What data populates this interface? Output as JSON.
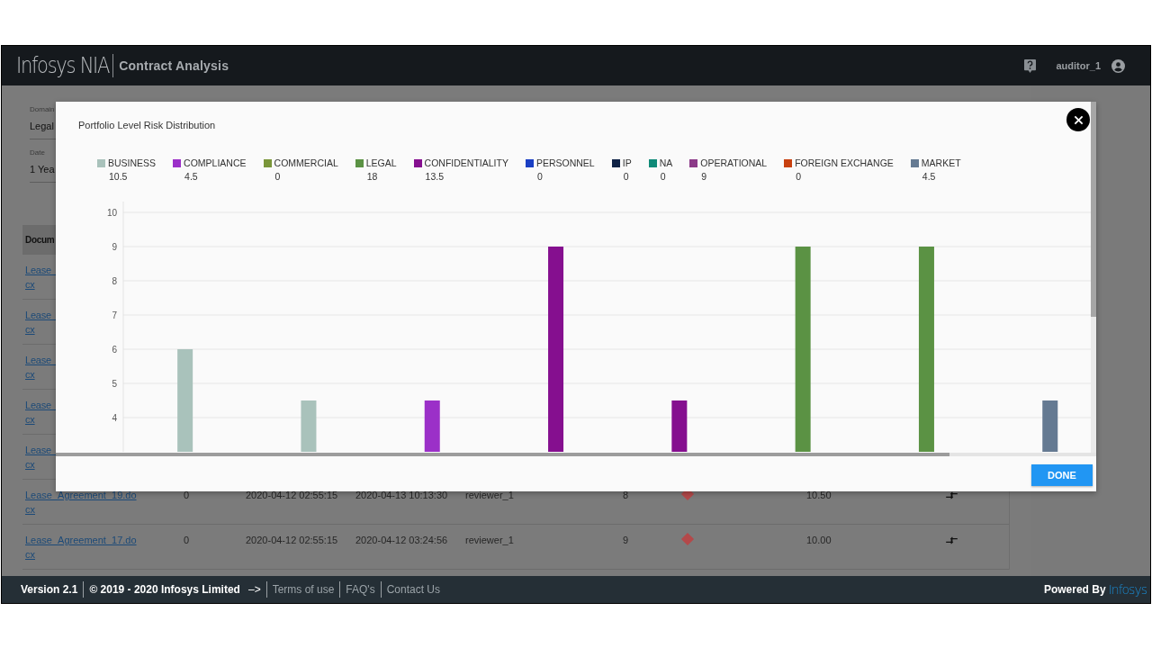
{
  "header": {
    "logo": "Infosys NIA",
    "title": "Contract Analysis",
    "user": "auditor_1"
  },
  "filters": [
    {
      "label": "Domain",
      "value": "Legal"
    },
    {
      "label": "Date",
      "value": "1 Yea"
    }
  ],
  "table": {
    "column_1": "Docum",
    "rows": [
      {
        "document": [
          "Lease_",
          "cx"
        ]
      },
      {
        "document": [
          "Lease_",
          "cx"
        ]
      },
      {
        "document": [
          "Lease_",
          "cx"
        ]
      },
      {
        "document": [
          "Lease_",
          "cx"
        ]
      },
      {
        "document": [
          "Lease_",
          "cx"
        ]
      },
      {
        "document": [
          "Lease_Agreement_19.do",
          "cx"
        ],
        "column_2": "0",
        "created": "2020-04-12 02:55:15",
        "modified": "2020-04-13 10:13:30",
        "reviewer": "reviewer_1",
        "column_6": "8",
        "score": "10.50"
      },
      {
        "document": [
          "Lease_Agreement_17.do",
          "cx"
        ],
        "column_2": "0",
        "created": "2020-04-12 02:55:15",
        "modified": "2020-04-12 03:24:56",
        "reviewer": "reviewer_1",
        "column_6": "9",
        "score": "10.00"
      }
    ]
  },
  "modal": {
    "title": "Portfolio Level Risk Distribution",
    "legend_totals": [
      "10.5",
      "4.5",
      "0",
      "18",
      "13.5",
      "0",
      "0",
      "0",
      "9",
      "0",
      "4.5"
    ],
    "chart_data": {
      "type": "bar",
      "ylim": [
        3,
        10
      ],
      "yticks": [
        4,
        5,
        6,
        7,
        8,
        9,
        10
      ],
      "grid": true,
      "series": [
        {
          "name": "BUSINESS",
          "color": "#a9c2bb",
          "values": [
            6,
            4.5,
            null,
            null,
            null,
            null,
            null,
            null
          ]
        },
        {
          "name": "COMPLIANCE",
          "color": "#9b30c8",
          "values": [
            null,
            null,
            4.5,
            null,
            null,
            null,
            null,
            null
          ]
        },
        {
          "name": "COMMERCIAL",
          "color": "#7a963a",
          "values": [
            null,
            null,
            null,
            null,
            null,
            null,
            null,
            null
          ]
        },
        {
          "name": "LEGAL",
          "color": "#5b9244",
          "values": [
            null,
            null,
            null,
            null,
            null,
            9,
            9,
            null
          ]
        },
        {
          "name": "CONFIDENTIALITY",
          "color": "#850f8f",
          "values": [
            null,
            null,
            null,
            9,
            4.5,
            null,
            null,
            null
          ]
        },
        {
          "name": "PERSONNEL",
          "color": "#1a3fc4",
          "values": [
            null,
            null,
            null,
            null,
            null,
            null,
            null,
            null
          ]
        },
        {
          "name": "IP",
          "color": "#0f2245",
          "values": [
            null,
            null,
            null,
            null,
            null,
            null,
            null,
            null
          ]
        },
        {
          "name": "NA",
          "color": "#0f8a78",
          "values": [
            null,
            null,
            null,
            null,
            null,
            null,
            null,
            null
          ]
        },
        {
          "name": "OPERATIONAL",
          "color": "#8c3a88",
          "values": [
            null,
            null,
            null,
            null,
            null,
            null,
            null,
            null
          ]
        },
        {
          "name": "FOREIGN EXCHANGE",
          "color": "#c8400f",
          "values": [
            null,
            null,
            null,
            null,
            null,
            null,
            null,
            null
          ]
        },
        {
          "name": "MARKET",
          "color": "#657a92",
          "values": [
            null,
            null,
            null,
            null,
            null,
            null,
            null,
            4.5
          ]
        }
      ]
    },
    "button": "DONE"
  },
  "footer": {
    "version": "Version 2.1",
    "copyright": "© 2019 - 2020 Infosys Limited",
    "arrow": "–>",
    "links": [
      "Terms of use",
      "FAQ's",
      "Contact Us"
    ],
    "powered": "Powered By",
    "brand": "Infosys"
  }
}
